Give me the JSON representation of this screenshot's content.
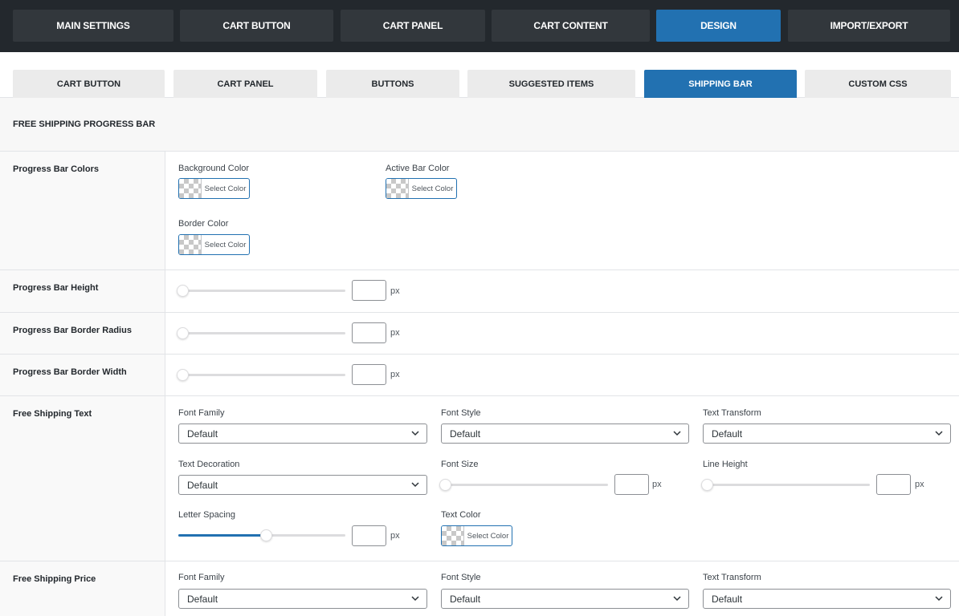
{
  "top_tabs": [
    {
      "label": "MAIN SETTINGS"
    },
    {
      "label": "CART BUTTON"
    },
    {
      "label": "CART PANEL"
    },
    {
      "label": "CART CONTENT"
    },
    {
      "label": "DESIGN",
      "active": true
    },
    {
      "label": "IMPORT/EXPORT"
    }
  ],
  "sub_tabs": [
    {
      "label": "CART BUTTON"
    },
    {
      "label": "CART PANEL"
    },
    {
      "label": "BUTTONS"
    },
    {
      "label": "SUGGESTED ITEMS"
    },
    {
      "label": "SHIPPING BAR",
      "active": true
    },
    {
      "label": "CUSTOM CSS"
    }
  ],
  "section_title": "FREE SHIPPING PROGRESS BAR",
  "colors": {
    "accent": "#2271b1",
    "topbar": "#23282d",
    "tab": "#32373c"
  },
  "rows": {
    "colors": {
      "label": "Progress Bar Colors",
      "background_color_label": "Background Color",
      "active_bar_color_label": "Active Bar Color",
      "border_color_label": "Border Color",
      "select_color": "Select Color"
    },
    "height": {
      "label": "Progress Bar Height",
      "unit": "px",
      "value": "",
      "slider": 0
    },
    "radius": {
      "label": "Progress Bar Border Radius",
      "unit": "px",
      "value": "",
      "slider": 0
    },
    "width": {
      "label": "Progress Bar Border Width",
      "unit": "px",
      "value": "",
      "slider": 0
    },
    "text": {
      "label": "Free Shipping Text",
      "font_family_label": "Font Family",
      "font_family": "Default",
      "font_style_label": "Font Style",
      "font_style": "Default",
      "text_transform_label": "Text Transform",
      "text_transform": "Default",
      "text_decoration_label": "Text Decoration",
      "text_decoration": "Default",
      "font_size_label": "Font Size",
      "font_size_unit": "px",
      "font_size_slider": 0,
      "line_height_label": "Line Height",
      "line_height_unit": "px",
      "line_height_slider": 0,
      "letter_spacing_label": "Letter Spacing",
      "letter_spacing_unit": "px",
      "letter_spacing_slider": 0.5,
      "text_color_label": "Text Color",
      "select_color": "Select Color"
    },
    "price": {
      "label": "Free Shipping Price",
      "font_family_label": "Font Family",
      "font_family": "Default",
      "font_style_label": "Font Style",
      "font_style": "Default",
      "text_transform_label": "Text Transform",
      "text_transform": "Default"
    }
  }
}
